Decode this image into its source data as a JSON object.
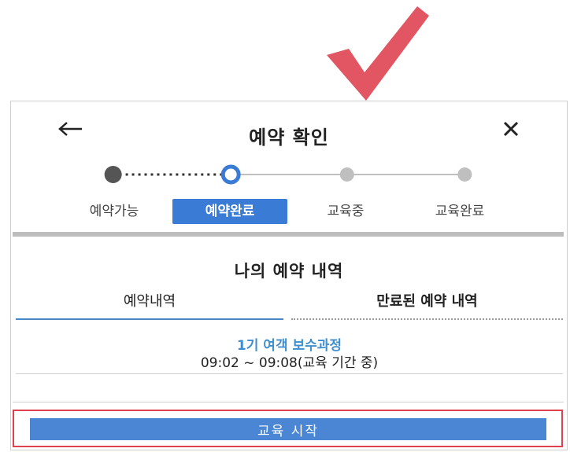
{
  "annotation": {
    "checkmark_icon": "checkmark-icon",
    "color": "#e25562"
  },
  "header": {
    "title": "예약 확인",
    "back_icon": "back-arrow-icon",
    "close_label": "X"
  },
  "stepper": {
    "steps": [
      {
        "label": "예약가능",
        "state": "done"
      },
      {
        "label": "예약완료",
        "state": "active"
      },
      {
        "label": "교육중",
        "state": "pending"
      },
      {
        "label": "교육완료",
        "state": "pending"
      }
    ],
    "colors": {
      "done": "#555555",
      "active": "#3a7bd5",
      "pending": "#bfbfbf"
    }
  },
  "section": {
    "title": "나의 예약 내역"
  },
  "tabs": [
    {
      "label": "예약내역",
      "selected": true
    },
    {
      "label": "만료된 예약 내역",
      "selected": false
    }
  ],
  "reservation": {
    "course_name": "1기 여객 보수과정",
    "time": "09:02 ~ 09:08(교육 기간 중)"
  },
  "actions": {
    "start_label": "교육 시작"
  }
}
